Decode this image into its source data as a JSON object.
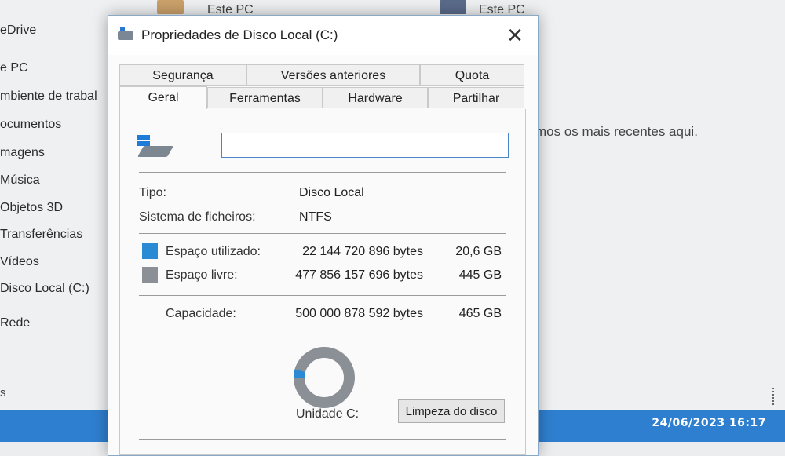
{
  "explorer": {
    "top_items": [
      "Este PC",
      "Este PC"
    ],
    "nav_items": [
      "eDrive",
      "e PC",
      "mbiente de trabal",
      "ocumentos",
      "magens",
      "Música",
      "Objetos 3D",
      "Transferências",
      "Vídeos",
      "Disco Local (C:)",
      "Rede"
    ],
    "empty_message": "mos os mais recentes aqui.",
    "status_fragment": "s"
  },
  "taskbar": {
    "datetime": "24/06/2023  16:17"
  },
  "dialog": {
    "title": "Propriedades de Disco Local (C:)",
    "close_glyph": "✕",
    "tabs_row1": [
      "Segurança",
      "Versões anteriores",
      "Quota"
    ],
    "tabs_row2": [
      "Geral",
      "Ferramentas",
      "Hardware",
      "Partilhar"
    ],
    "active_tab": "Geral",
    "drive_name_value": "",
    "type_label": "Tipo:",
    "type_value": "Disco Local",
    "fs_label": "Sistema de ficheiros:",
    "fs_value": "NTFS",
    "used_label": "Espaço utilizado:",
    "used_bytes": "22 144 720 896 bytes",
    "used_size": "20,6 GB",
    "free_label": "Espaço livre:",
    "free_bytes": "477 856 157 696 bytes",
    "free_size": "445 GB",
    "capacity_label": "Capacidade:",
    "capacity_bytes": "500 000 878 592 bytes",
    "capacity_size": "465 GB",
    "drive_label": "Unidade C:",
    "cleanup_button": "Limpeza do disco",
    "used_fraction": 0.0443,
    "colors": {
      "used": "#2a8ad4",
      "free": "#8a9096"
    }
  }
}
